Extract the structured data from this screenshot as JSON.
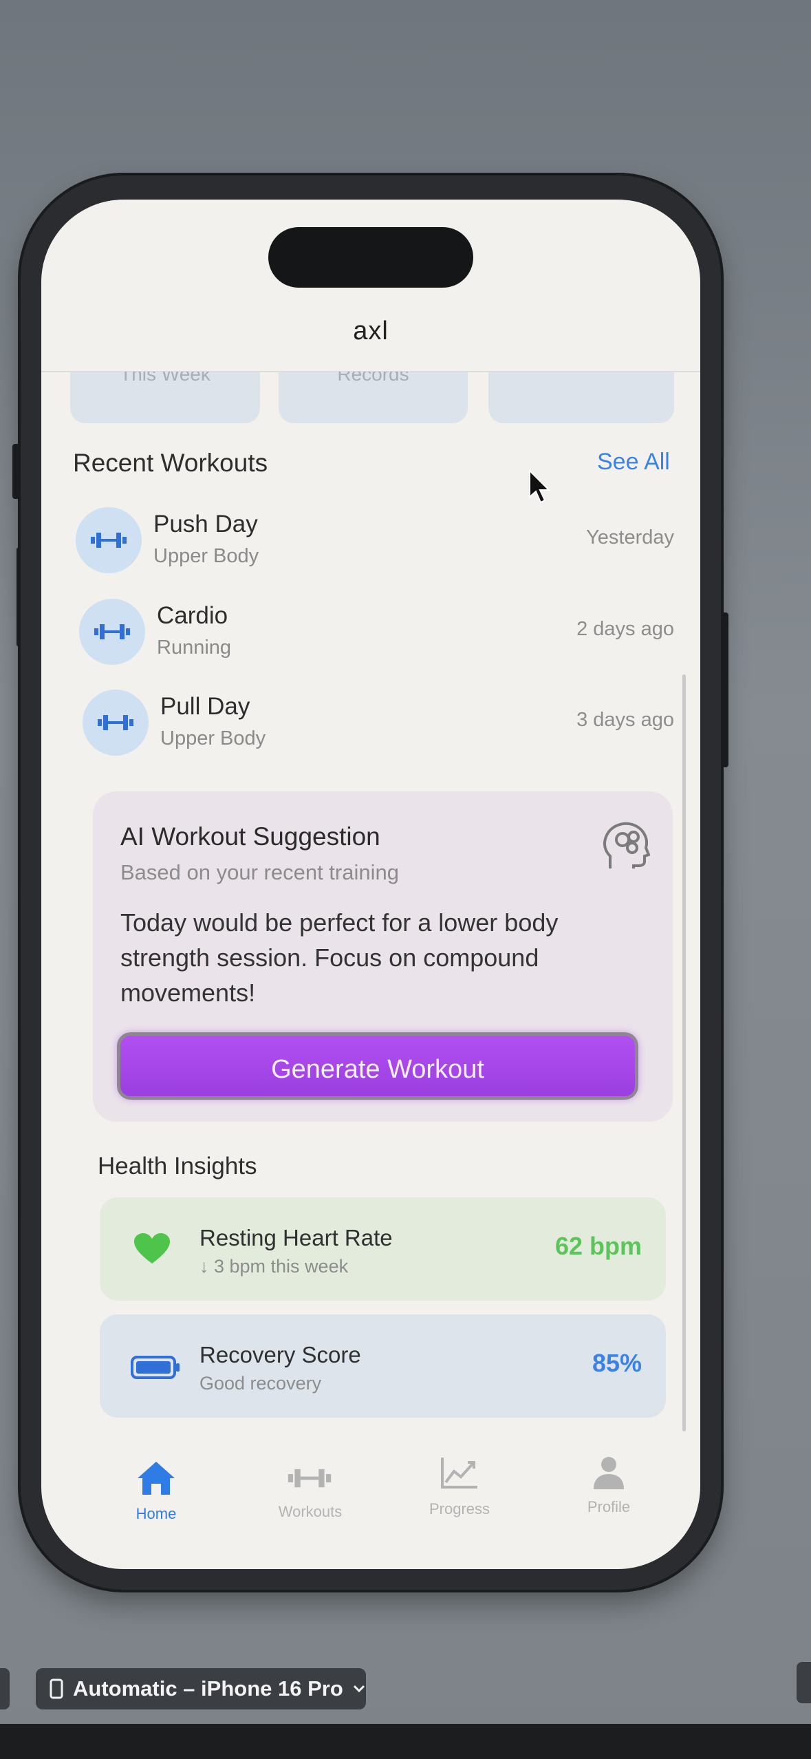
{
  "app": {
    "nav_title": "axl"
  },
  "stats_cards": [
    {
      "label": "This Week"
    },
    {
      "label": "Records"
    },
    {
      "label": ""
    }
  ],
  "recent": {
    "title": "Recent Workouts",
    "see_all": "See All",
    "items": [
      {
        "name": "Push Day",
        "category": "Upper Body",
        "time": "Yesterday",
        "icon": "dumbbell-icon"
      },
      {
        "name": "Cardio",
        "category": "Running",
        "time": "2 days ago",
        "icon": "dumbbell-icon"
      },
      {
        "name": "Pull Day",
        "category": "Upper Body",
        "time": "3 days ago",
        "icon": "dumbbell-icon"
      }
    ]
  },
  "ai": {
    "title": "AI Workout Suggestion",
    "subtitle": "Based on your recent training",
    "body": "Today would be perfect for a lower body strength session. Focus on compound movements!",
    "button": "Generate Workout",
    "icon": "brain-head-icon"
  },
  "health": {
    "title": "Health Insights",
    "items": [
      {
        "title": "Resting Heart Rate",
        "sub": "↓ 3 bpm this week",
        "value": "62 bpm",
        "color": "#5cc45a",
        "bg": "#e3ecdc",
        "icon": "heart-icon"
      },
      {
        "title": "Recovery Score",
        "sub": "Good recovery",
        "value": "85%",
        "color": "#3a83e6",
        "bg": "#dde4ec",
        "icon": "battery-icon"
      }
    ]
  },
  "tabs": [
    {
      "label": "Home",
      "icon": "house-icon",
      "active": true
    },
    {
      "label": "Workouts",
      "icon": "dumbbell-icon",
      "active": false
    },
    {
      "label": "Progress",
      "icon": "chart-line-icon",
      "active": false
    },
    {
      "label": "Profile",
      "icon": "person-icon",
      "active": false
    }
  ],
  "device_selector": {
    "label": "Automatic – iPhone 16 Pro",
    "icon": "phone-icon"
  },
  "colors": {
    "accent": "#3a83e6",
    "button": "#a747ea",
    "tab_inactive": "#b3b3b3"
  }
}
